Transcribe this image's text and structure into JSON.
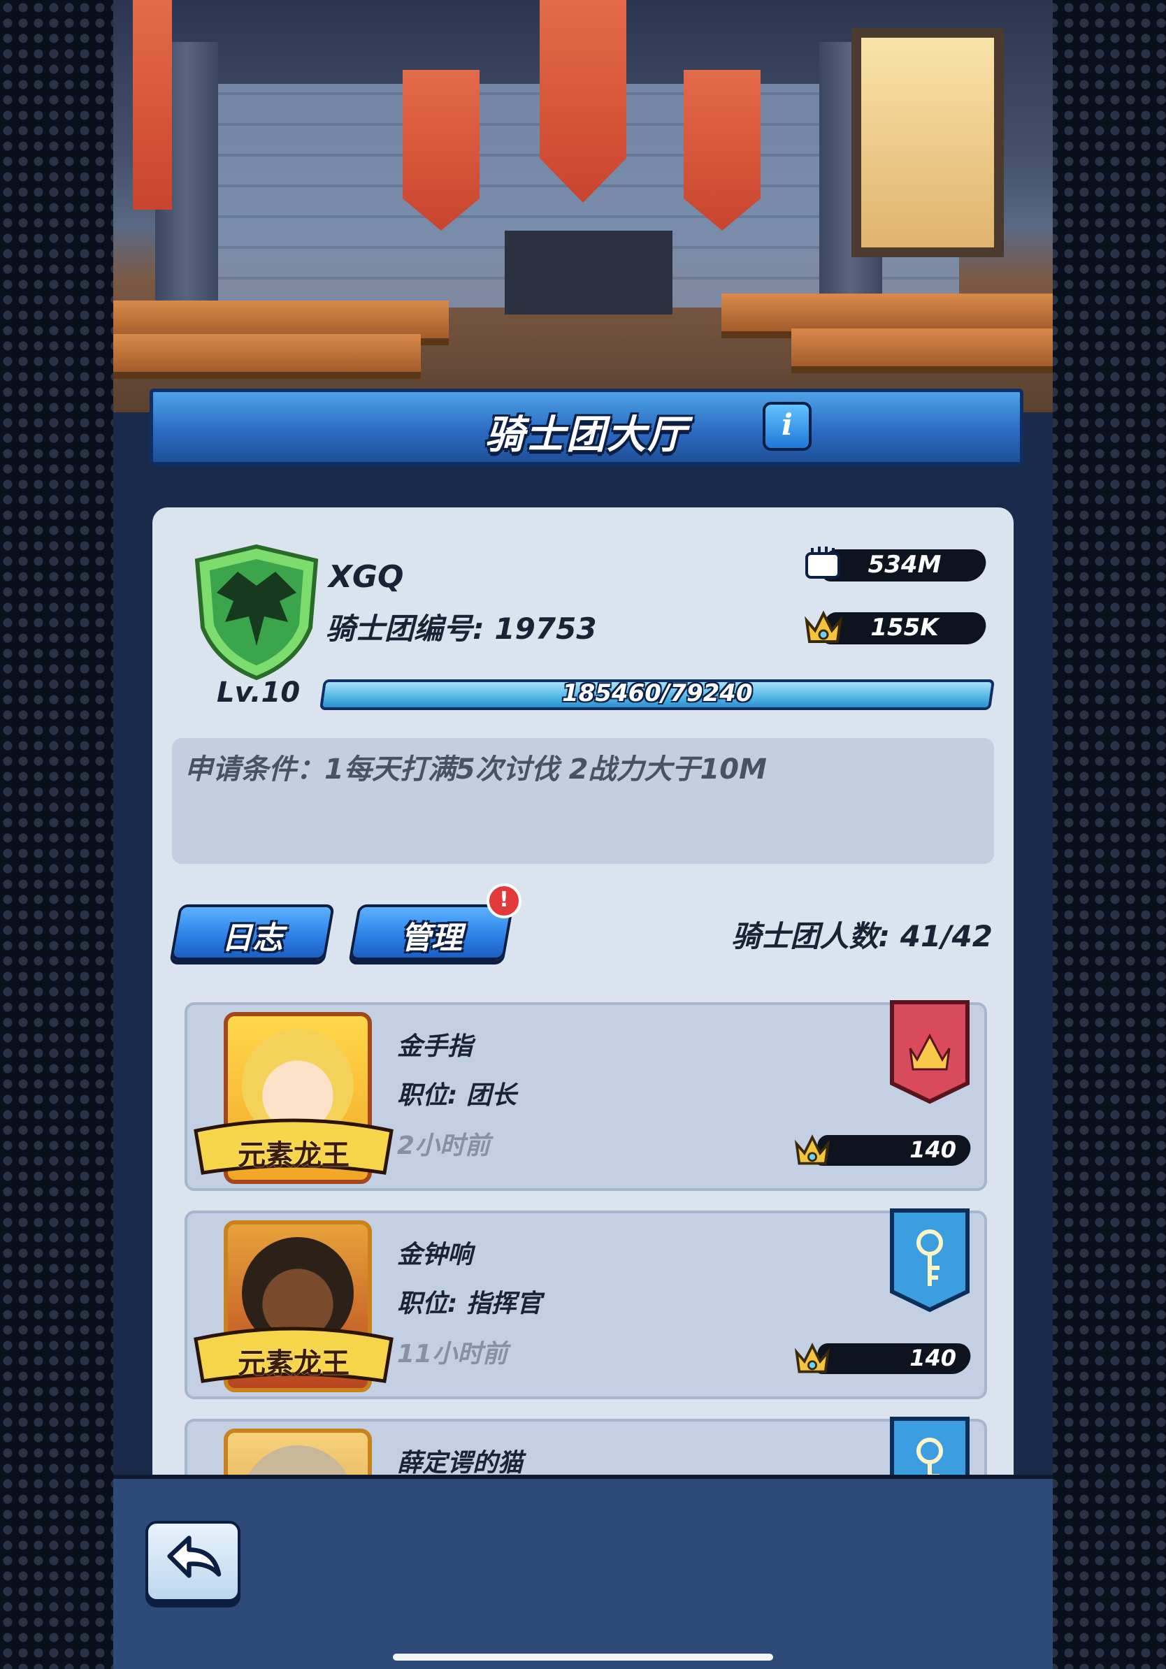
{
  "header": {
    "title": "骑士团大厅",
    "info_label": "i"
  },
  "guild": {
    "name": "XGQ",
    "id_text": "骑士团编号: 19753",
    "level_text": "Lv.10",
    "xp_text": "185460/79240",
    "xp_progress": 1.0,
    "power_value": "534M",
    "crown_value": "155K"
  },
  "conditions": {
    "text": "申请条件：1每天打满5次讨伐 2战力大于10M"
  },
  "buttons": {
    "log_label": "日志",
    "manage_label": "管理",
    "manage_alert": "!"
  },
  "member_count_text": "骑士团人数: 41/42",
  "members": [
    {
      "name": "金手指",
      "role": "职位: 团长",
      "last_seen": "2小时前",
      "tag": "元素龙王",
      "crown_value": "140",
      "flag": "red-crown-banner"
    },
    {
      "name": "金钟响",
      "role": "职位: 指挥官",
      "last_seen": "11小时前",
      "tag": "元素龙王",
      "crown_value": "140",
      "flag": "blue-key-banner"
    },
    {
      "name": "薛定谔的猫",
      "role": "",
      "last_seen": "",
      "tag": "",
      "crown_value": "",
      "flag": "blue-key-banner"
    }
  ],
  "colors": {
    "accent_blue": "#2a7ee6",
    "panel": "#dbe3ee",
    "row": "#c3d0e3",
    "alert_red": "#e23a3a",
    "gold": "#f3c43c"
  },
  "icons": [
    "info-icon",
    "fist-power-icon",
    "crown-icon",
    "shield-dragon-emblem",
    "back-arrow-icon",
    "alert-icon"
  ]
}
